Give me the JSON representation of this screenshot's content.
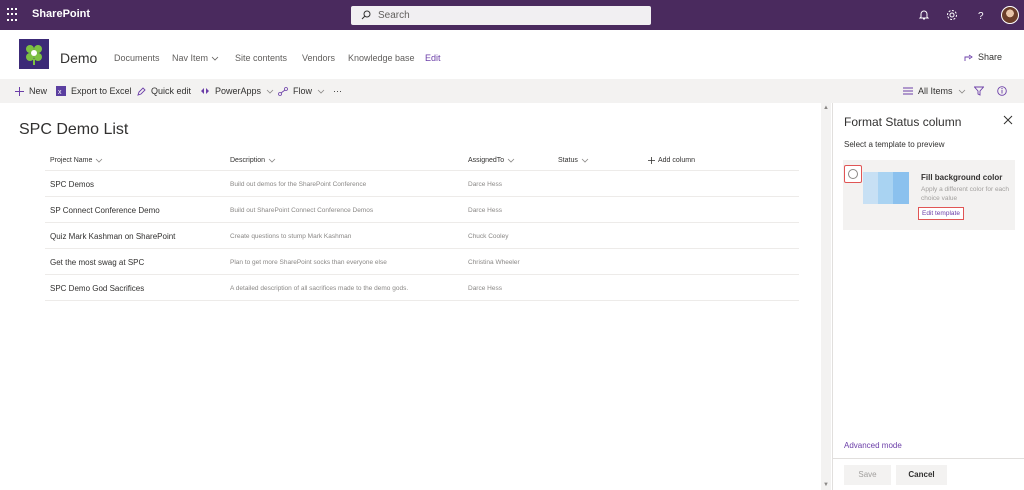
{
  "suite_bar": {
    "brand": "SharePoint",
    "search_placeholder": "Search",
    "bg_color": "#4a2a5e",
    "icons": [
      "waffle-icon",
      "bell-icon",
      "gear-icon",
      "help-icon",
      "avatar"
    ]
  },
  "site_header": {
    "title": "Demo",
    "nav": [
      "Documents",
      "Nav Item",
      "Site contents",
      "Vendors",
      "Knowledge base",
      "Edit"
    ],
    "share_label": "Share"
  },
  "command_bar": {
    "new_label": "New",
    "export_label": "Export to Excel",
    "quick_edit_label": "Quick edit",
    "powerapps_label": "PowerApps",
    "flow_label": "Flow",
    "more_label": "···",
    "view_label": "All Items"
  },
  "list": {
    "title": "SPC Demo List",
    "columns": {
      "project_name": "Project Name",
      "description": "Description",
      "assigned_to": "AssignedTo",
      "status": "Status",
      "add_column": "Add column"
    },
    "rows": [
      {
        "name": "SPC Demos",
        "description": "Build out demos for the SharePoint Conference",
        "assigned": "Darce Hess"
      },
      {
        "name": "SP Connect Conference Demo",
        "description": "Build out SharePoint Connect Conference Demos",
        "assigned": "Darce Hess"
      },
      {
        "name": "Quiz Mark Kashman on SharePoint",
        "description": "Create questions to stump Mark Kashman",
        "assigned": "Chuck Cooley"
      },
      {
        "name": "Get the most swag at SPC",
        "description": "Plan to get more SharePoint socks than everyone else",
        "assigned": "Christina Wheeler"
      },
      {
        "name": "SPC Demo God Sacrifices",
        "description": "A detailed description of all sacrifices made to the demo gods.",
        "assigned": "Darce Hess"
      }
    ]
  },
  "panel": {
    "title": "Format Status column",
    "subtitle": "Select a template to preview",
    "template": {
      "name": "Fill background color",
      "description": "Apply a different color for each choice value",
      "edit_label": "Edit template"
    },
    "advanced_label": "Advanced mode",
    "save_label": "Save",
    "cancel_label": "Cancel"
  },
  "colors": {
    "accent": "#6b3ea8",
    "highlight_border": "#e05555",
    "swatch_light": "#c7e0f4",
    "swatch_mid": "#a9d3f2",
    "swatch_dark": "#8bc1ee"
  }
}
